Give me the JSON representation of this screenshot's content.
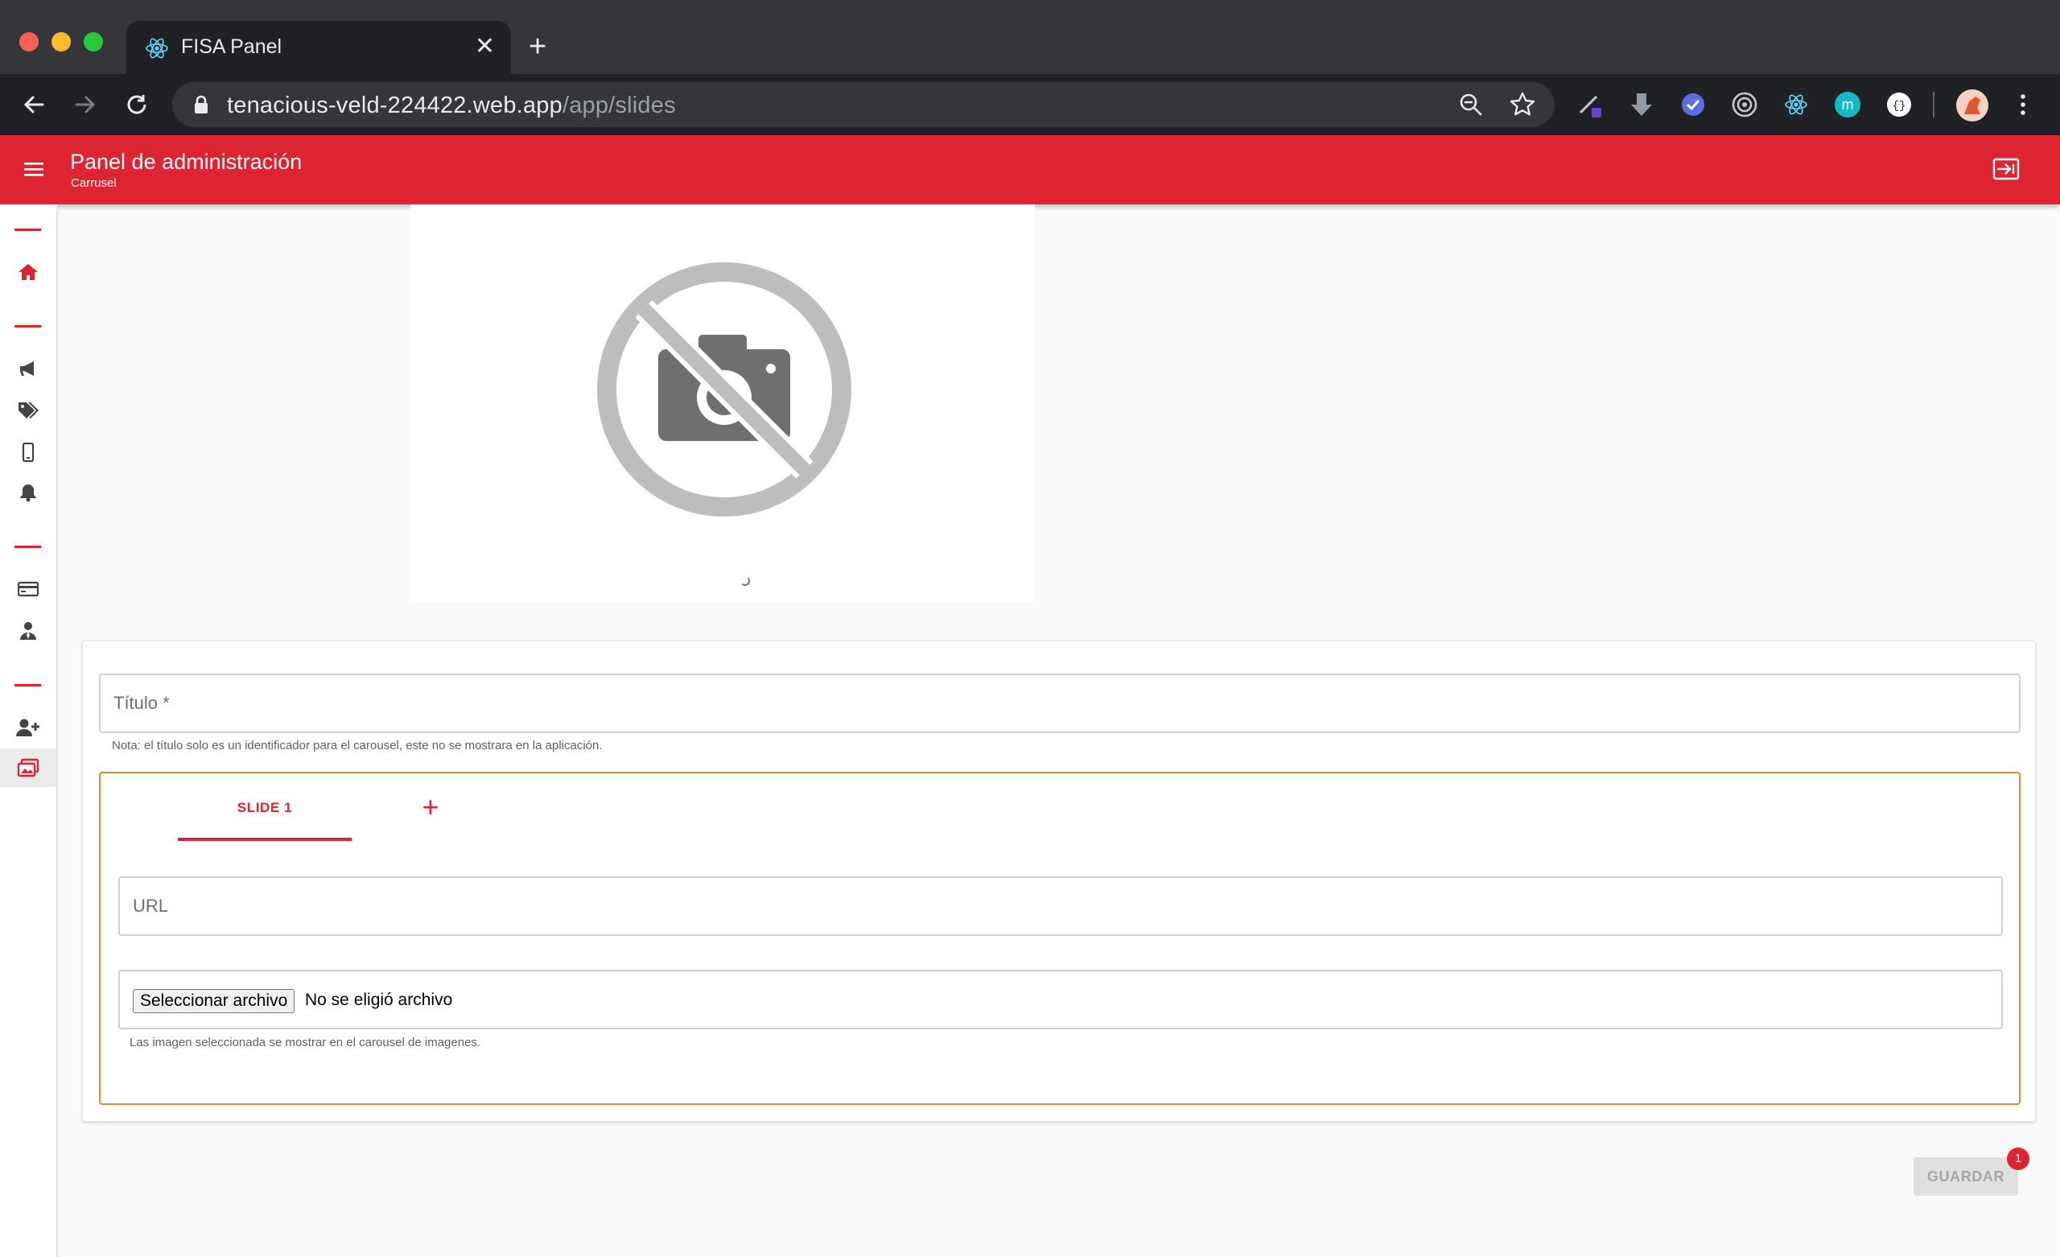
{
  "browser": {
    "tab_title": "FISA Panel",
    "url_host": "tenacious-veld-224422.web.app",
    "url_path": "/app/slides",
    "icons": [
      "react-icon",
      "close-icon",
      "new-tab-icon",
      "back-icon",
      "forward-icon",
      "reload-icon",
      "lock-icon",
      "zoom-icon",
      "bookmark-star-icon",
      "extension-icons",
      "profile-avatar",
      "kebab-menu-icon"
    ]
  },
  "header": {
    "title": "Panel de administración",
    "subtitle": "Carrusel",
    "accent_color": "#dc2432"
  },
  "sidebar": {
    "items": [
      {
        "icon": "home-icon"
      },
      {
        "icon": "megaphone-icon"
      },
      {
        "icon": "tags-icon"
      },
      {
        "icon": "mobile-icon"
      },
      {
        "icon": "bell-icon"
      },
      {
        "icon": "credit-card-icon"
      },
      {
        "icon": "user-tie-icon"
      },
      {
        "icon": "user-plus-icon"
      },
      {
        "icon": "images-icon",
        "active": true
      }
    ]
  },
  "preview": {
    "icon": "no-photo-icon"
  },
  "form": {
    "title_label": "Título *",
    "title_helper": "Nota: el título solo es un identificador para el carousel, este no se mostrara en la aplicación.",
    "tabs": [
      {
        "label": "SLIDE 1",
        "active": true
      }
    ],
    "add_tab_label": "+",
    "url_label": "URL",
    "file_button": "Seleccionar archivo",
    "file_status": "No se eligió archivo",
    "file_helper": "Las imagen seleccionada se mostrar en el carousel de imagenes.",
    "outline_color": "#e48a33"
  },
  "actions": {
    "save_label": "GUARDAR",
    "badge_count": "1"
  }
}
